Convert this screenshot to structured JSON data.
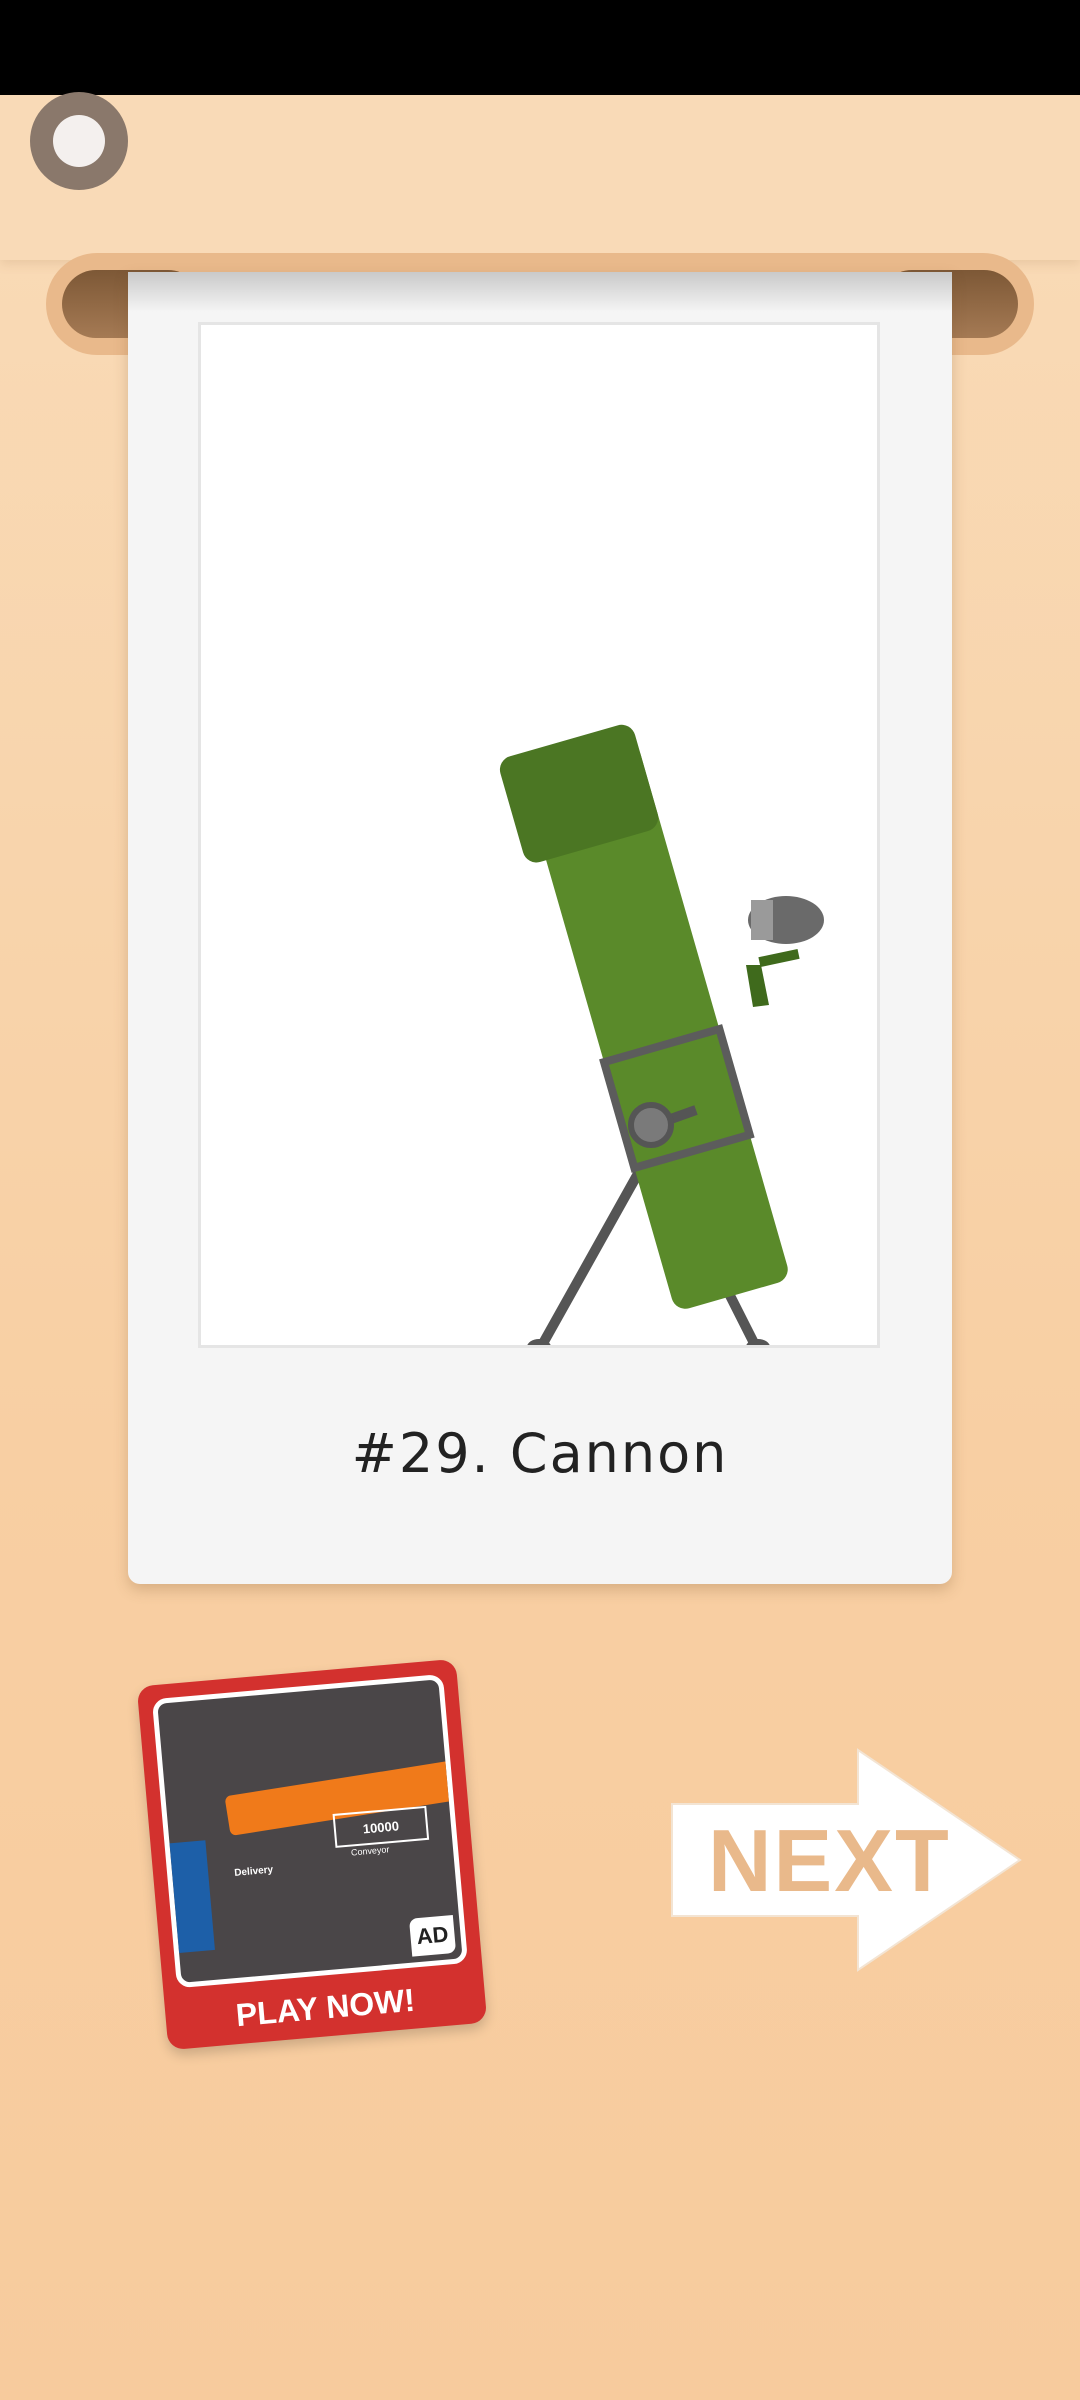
{
  "record_button": {
    "icon": "record-icon"
  },
  "card": {
    "caption": "#29. Cannon",
    "illustration": "cannon-on-tripod"
  },
  "ad": {
    "price_text": "10000",
    "label_left": "Delivery",
    "label_right": "Conveyor",
    "badge": "AD",
    "cta": "PLAY NOW!"
  },
  "next_button": {
    "label": "NEXT"
  },
  "colors": {
    "background": "#f8cfa3",
    "accent": "#e9b98b",
    "cannon_green": "#5a8a2a",
    "ad_red": "#d3312e"
  }
}
